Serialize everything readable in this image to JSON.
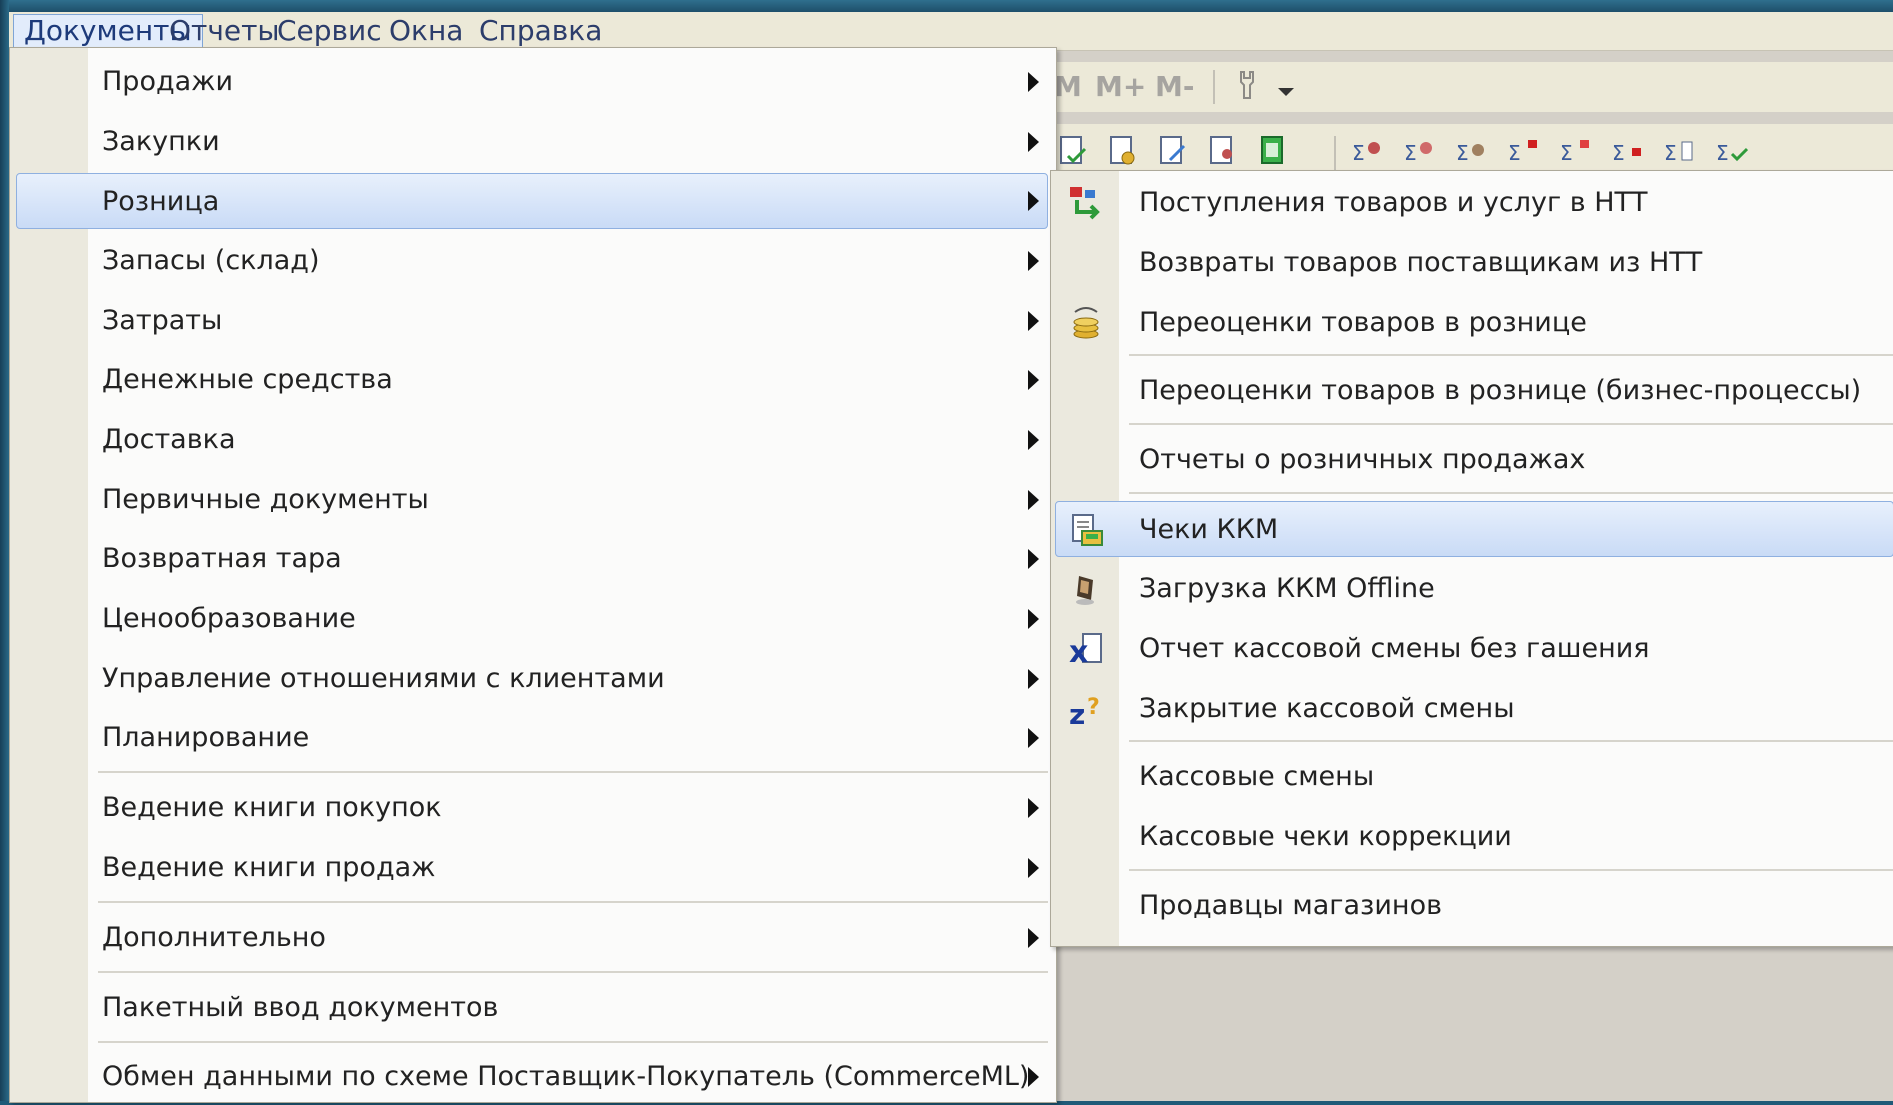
{
  "menubar": {
    "items": [
      "Документы",
      "Отчеты",
      "Сервис",
      "Окна",
      "Справка"
    ],
    "active_index": 0
  },
  "toolbar": {
    "m_label": "M",
    "mplus_label": "M+",
    "mminus_label": "M-"
  },
  "documents_menu": {
    "items": [
      {
        "label": "Продажи",
        "submenu": true
      },
      {
        "label": "Закупки",
        "submenu": true
      },
      {
        "label": "Розница",
        "submenu": true,
        "highlighted": true
      },
      {
        "label": "Запасы (склад)",
        "submenu": true
      },
      {
        "label": "Затраты",
        "submenu": true
      },
      {
        "label": "Денежные средства",
        "submenu": true
      },
      {
        "label": "Доставка",
        "submenu": true
      },
      {
        "label": "Первичные документы",
        "submenu": true
      },
      {
        "label": "Возвратная тара",
        "submenu": true
      },
      {
        "label": "Ценообразование",
        "submenu": true
      },
      {
        "label": "Управление отношениями с клиентами",
        "submenu": true
      },
      {
        "label": "Планирование",
        "submenu": true
      },
      {
        "label": "Ведение книги покупок",
        "submenu": true
      },
      {
        "label": "Ведение книги продаж",
        "submenu": true
      },
      {
        "label": "Дополнительно",
        "submenu": true
      },
      {
        "label": "Пакетный ввод документов",
        "submenu": false
      },
      {
        "label": "Обмен данными по схеме Поставщик-Покупатель (CommerceML)",
        "submenu": true
      }
    ]
  },
  "retail_submenu": {
    "items": [
      {
        "label": "Поступления товаров и услуг в НТТ",
        "icon": "goods-receipt-icon"
      },
      {
        "label": "Возвраты товаров поставщикам из НТТ",
        "icon": ""
      },
      {
        "label": "Переоценки товаров в рознице",
        "icon": "revaluation-coins-icon"
      },
      {
        "label": "Переоценки товаров в рознице (бизнес-процессы)",
        "icon": ""
      },
      {
        "label": "Отчеты о розничных продажах",
        "icon": ""
      },
      {
        "label": "Чеки ККМ",
        "icon": "cash-receipt-icon",
        "highlighted": true
      },
      {
        "label": "Загрузка ККМ Offline",
        "icon": "loading-icon"
      },
      {
        "label": "Отчет кассовой смены без гашения",
        "icon": "x-report-icon"
      },
      {
        "label": "Закрытие кассовой смены",
        "icon": "z-report-icon"
      },
      {
        "label": "Кассовые смены",
        "icon": ""
      },
      {
        "label": "Кассовые чеки коррекции",
        "icon": ""
      },
      {
        "label": "Продавцы магазинов",
        "icon": ""
      }
    ]
  }
}
